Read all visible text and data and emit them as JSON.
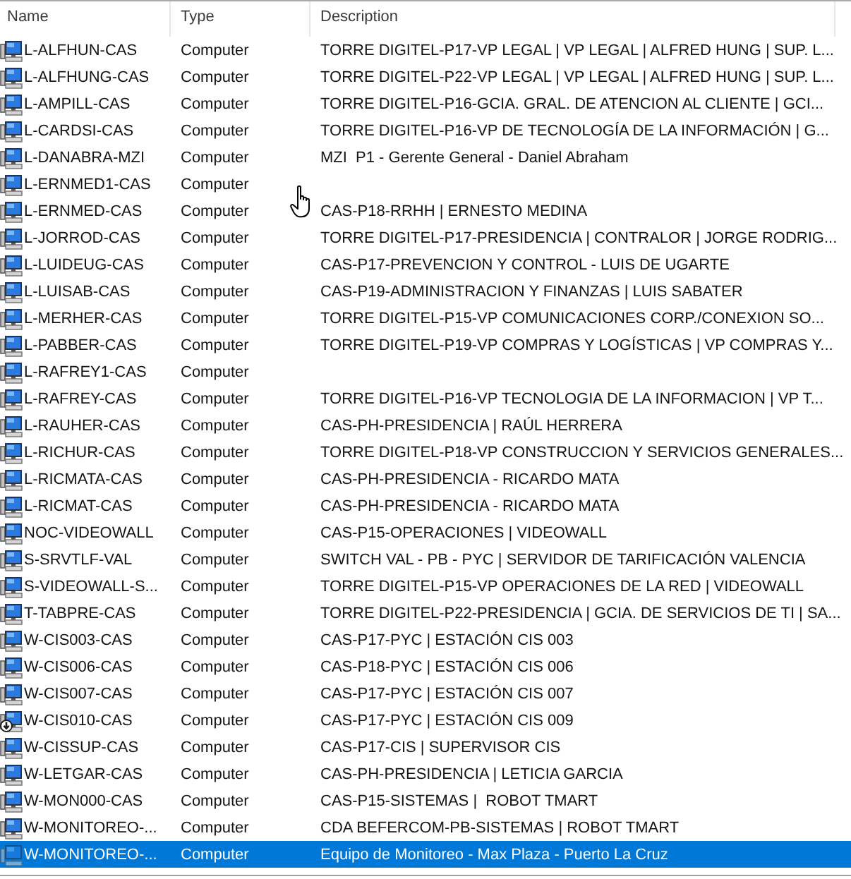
{
  "columns": [
    {
      "label": "Name"
    },
    {
      "label": "Type"
    },
    {
      "label": "Description"
    }
  ],
  "rows": [
    {
      "name": "L-ALFHUN-CAS",
      "type": "Computer",
      "description": "TORRE DIGITEL-P17-VP LEGAL | VP LEGAL | ALFRED HUNG | SUP. L...",
      "disabled": false,
      "selected": false
    },
    {
      "name": "L-ALFHUNG-CAS",
      "type": "Computer",
      "description": "TORRE DIGITEL-P22-VP LEGAL | VP LEGAL | ALFRED HUNG | SUP. L...",
      "disabled": false,
      "selected": false
    },
    {
      "name": "L-AMPILL-CAS",
      "type": "Computer",
      "description": "TORRE DIGITEL-P16-GCIA. GRAL. DE ATENCION AL CLIENTE | GCI...",
      "disabled": false,
      "selected": false
    },
    {
      "name": "L-CARDSI-CAS",
      "type": "Computer",
      "description": "TORRE DIGITEL-P16-VP DE TECNOLOGÍA DE LA INFORMACIÓN | G...",
      "disabled": false,
      "selected": false
    },
    {
      "name": "L-DANABRA-MZI",
      "type": "Computer",
      "description": "MZI  P1 - Gerente General - Daniel Abraham",
      "disabled": false,
      "selected": false
    },
    {
      "name": "L-ERNMED1-CAS",
      "type": "Computer",
      "disabled": false,
      "selected": false
    },
    {
      "name": "L-ERNMED-CAS",
      "type": "Computer",
      "description": "CAS-P18-RRHH | ERNESTO MEDINA",
      "disabled": false,
      "selected": false
    },
    {
      "name": "L-JORROD-CAS",
      "type": "Computer",
      "description": "TORRE DIGITEL-P17-PRESIDENCIA | CONTRALOR | JORGE RODRIG...",
      "disabled": false,
      "selected": false
    },
    {
      "name": "L-LUIDEUG-CAS",
      "type": "Computer",
      "description": "CAS-P17-PREVENCION Y CONTROL - LUIS DE UGARTE",
      "disabled": false,
      "selected": false
    },
    {
      "name": "L-LUISAB-CAS",
      "type": "Computer",
      "description": "CAS-P19-ADMINISTRACION Y FINANZAS | LUIS SABATER",
      "disabled": false,
      "selected": false
    },
    {
      "name": "L-MERHER-CAS",
      "type": "Computer",
      "description": "TORRE DIGITEL-P15-VP COMUNICACIONES CORP./CONEXION SO...",
      "disabled": false,
      "selected": false
    },
    {
      "name": "L-PABBER-CAS",
      "type": "Computer",
      "description": "TORRE DIGITEL-P19-VP COMPRAS Y LOGÍSTICAS | VP COMPRAS Y...",
      "disabled": false,
      "selected": false
    },
    {
      "name": "L-RAFREY1-CAS",
      "type": "Computer",
      "disabled": false,
      "selected": false
    },
    {
      "name": "L-RAFREY-CAS",
      "type": "Computer",
      "description": "TORRE DIGITEL-P16-VP TECNOLOGIA DE LA INFORMACION | VP T...",
      "disabled": false,
      "selected": false
    },
    {
      "name": "L-RAUHER-CAS",
      "type": "Computer",
      "description": "CAS-PH-PRESIDENCIA | RAÚL HERRERA",
      "disabled": false,
      "selected": false
    },
    {
      "name": "L-RICHUR-CAS",
      "type": "Computer",
      "description": "TORRE DIGITEL-P18-VP CONSTRUCCION Y SERVICIOS GENERALES...",
      "disabled": false,
      "selected": false
    },
    {
      "name": "L-RICMATA-CAS",
      "type": "Computer",
      "description": "CAS-PH-PRESIDENCIA - RICARDO MATA",
      "disabled": false,
      "selected": false
    },
    {
      "name": "L-RICMAT-CAS",
      "type": "Computer",
      "description": "CAS-PH-PRESIDENCIA - RICARDO MATA",
      "disabled": false,
      "selected": false
    },
    {
      "name": "NOC-VIDEOWALL",
      "type": "Computer",
      "description": "CAS-P15-OPERACIONES | VIDEOWALL",
      "disabled": false,
      "selected": false
    },
    {
      "name": "S-SRVTLF-VAL",
      "type": "Computer",
      "description": "SWITCH VAL - PB - PYC | SERVIDOR DE TARIFICACIÓN VALENCIA",
      "disabled": false,
      "selected": false
    },
    {
      "name": "S-VIDEOWALL-S...",
      "type": "Computer",
      "description": "TORRE DIGITEL-P15-VP OPERACIONES DE LA RED | VIDEOWALL",
      "disabled": false,
      "selected": false
    },
    {
      "name": "T-TABPRE-CAS",
      "type": "Computer",
      "description": "TORRE DIGITEL-P22-PRESIDENCIA | GCIA. DE SERVICIOS DE TI | SA...",
      "disabled": false,
      "selected": false
    },
    {
      "name": "W-CIS003-CAS",
      "type": "Computer",
      "description": "CAS-P17-PYC | ESTACIÓN CIS 003",
      "disabled": false,
      "selected": false
    },
    {
      "name": "W-CIS006-CAS",
      "type": "Computer",
      "description": "CAS-P18-PYC | ESTACIÓN CIS 006",
      "disabled": false,
      "selected": false
    },
    {
      "name": "W-CIS007-CAS",
      "type": "Computer",
      "description": "CAS-P17-PYC | ESTACIÓN CIS 007",
      "disabled": false,
      "selected": false
    },
    {
      "name": "W-CIS010-CAS",
      "type": "Computer",
      "description": "CAS-P17-PYC | ESTACIÓN CIS 009",
      "disabled": true,
      "selected": false
    },
    {
      "name": "W-CISSUP-CAS",
      "type": "Computer",
      "description": "CAS-P17-CIS | SUPERVISOR CIS",
      "disabled": false,
      "selected": false
    },
    {
      "name": "W-LETGAR-CAS",
      "type": "Computer",
      "description": "CAS-PH-PRESIDENCIA | LETICIA GARCIA",
      "disabled": false,
      "selected": false
    },
    {
      "name": "W-MON000-CAS",
      "type": "Computer",
      "description": "CAS-P15-SISTEMAS |  ROBOT TMART",
      "disabled": false,
      "selected": false
    },
    {
      "name": "W-MONITOREO-...",
      "type": "Computer",
      "description": "CDA BEFERCOM-PB-SISTEMAS | ROBOT TMART",
      "disabled": false,
      "selected": false
    },
    {
      "name": "W-MONITOREO-...",
      "type": "Computer",
      "description": "Equipo de Monitoreo - Max Plaza - Puerto La Cruz",
      "disabled": false,
      "selected": true
    }
  ]
}
